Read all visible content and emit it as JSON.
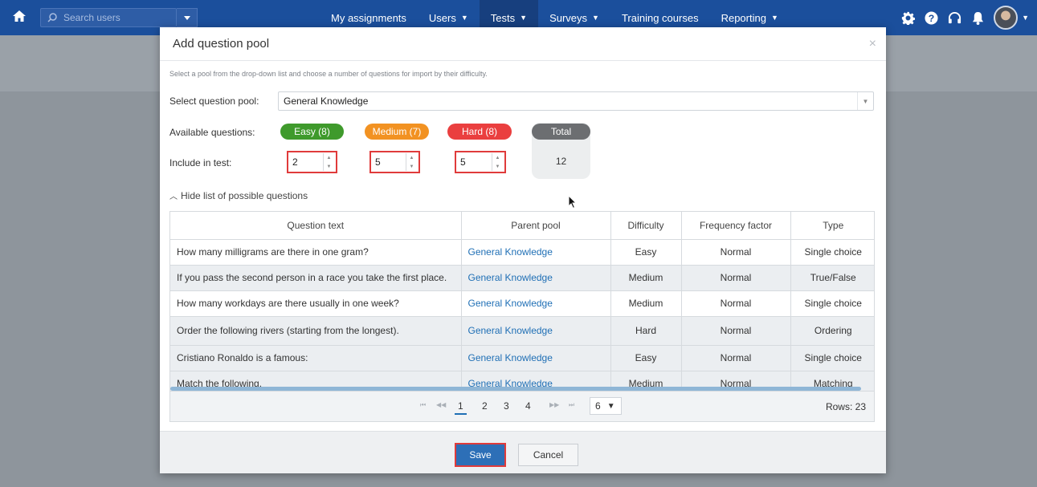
{
  "topbar": {
    "search_placeholder": "Search users",
    "nav": [
      {
        "label": "My assignments",
        "caret": false
      },
      {
        "label": "Users",
        "caret": true
      },
      {
        "label": "Tests",
        "caret": true,
        "active": true
      },
      {
        "label": "Surveys",
        "caret": true
      },
      {
        "label": "Training courses",
        "caret": false
      },
      {
        "label": "Reporting",
        "caret": true
      }
    ],
    "icons": [
      "gear-icon",
      "help-icon",
      "headset-icon",
      "bell-icon"
    ]
  },
  "modal": {
    "title": "Add question pool",
    "close": "×",
    "hint": "Select a pool from the drop-down list and choose a number of questions for import by their difficulty.",
    "pool_label": "Select question pool:",
    "pool_value": "General Knowledge",
    "available_label": "Available questions:",
    "include_label": "Include in test:",
    "difficulty": {
      "easy": "Easy (8)",
      "medium": "Medium (7)",
      "hard": "Hard (8)",
      "total": "Total"
    },
    "colors": {
      "easy": "#3f9a2c",
      "medium": "#f29222",
      "hard": "#ea3f3f",
      "total": "#6c6e71",
      "accent": "#1b4f9c"
    },
    "include": {
      "easy": "2",
      "medium": "5",
      "hard": "5",
      "total": "12"
    },
    "toggle_list": "Hide list of possible questions",
    "table": {
      "headers": {
        "question": "Question text",
        "pool": "Parent pool",
        "difficulty": "Difficulty",
        "frequency": "Frequency factor",
        "type": "Type"
      },
      "rows": [
        {
          "question": "How many milligrams are there in one gram?",
          "pool": "General Knowledge",
          "difficulty": "Easy",
          "frequency": "Normal",
          "type": "Single choice"
        },
        {
          "question": "If you pass the second person in a race you take the first place.",
          "pool": "General Knowledge",
          "difficulty": "Medium",
          "frequency": "Normal",
          "type": "True/False"
        },
        {
          "question": "How many workdays are there usually in one week?",
          "pool": "General Knowledge",
          "difficulty": "Medium",
          "frequency": "Normal",
          "type": "Single choice"
        },
        {
          "question": "Order the following rivers (starting from the longest).",
          "pool": "General Knowledge",
          "difficulty": "Hard",
          "frequency": "Normal",
          "type": "Ordering"
        },
        {
          "question": "Cristiano Ronaldo is a famous:",
          "pool": "General Knowledge",
          "difficulty": "Easy",
          "frequency": "Normal",
          "type": "Single choice"
        },
        {
          "question": "Match the following.",
          "pool": "General Knowledge",
          "difficulty": "Medium",
          "frequency": "Normal",
          "type": "Matching"
        }
      ]
    },
    "pager": {
      "pages": [
        "1",
        "2",
        "3",
        "4"
      ],
      "page_size": "6",
      "rows": "Rows: 23"
    },
    "save": "Save",
    "cancel": "Cancel"
  }
}
